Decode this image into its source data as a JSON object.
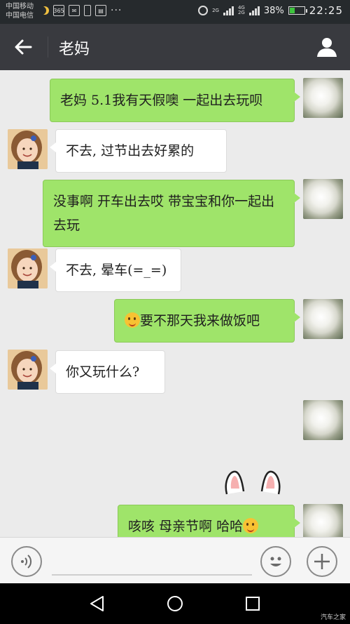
{
  "status_bar": {
    "carrier_1": "中国移动",
    "carrier_2": "中国电信",
    "icon_label_365": "365",
    "network_a": "2G",
    "network_b": "4G",
    "network_c": "2G",
    "battery": "38%",
    "battery_level": 0.38,
    "time": "22:25"
  },
  "title_bar": {
    "title": "老妈"
  },
  "messages": [
    {
      "side": "out",
      "text": "老妈 5.1我有天假噢 一起出去玩呗"
    },
    {
      "side": "in",
      "text": "不去, 过节出去好累的"
    },
    {
      "side": "out",
      "text": "没事啊 开车出去哎 带宝宝和你一起出去玩"
    },
    {
      "side": "in",
      "text": "不去, 晕车(=_=)"
    },
    {
      "side": "out",
      "text": "要不那天我来做饭吧",
      "emoji": "pleading-face"
    },
    {
      "side": "in",
      "text": "你又玩什么?"
    },
    {
      "side": "out",
      "sticker": "bunny-sticker"
    },
    {
      "side": "out",
      "text": "咳咳 母亲节啊 哈哈",
      "emoji": "grinning-face"
    }
  ],
  "input_bar": {
    "voice_icon": "voice-icon",
    "emoji_icon": "smiley-icon",
    "more_icon": "plus-icon"
  },
  "nav_bar": {
    "back_icon": "triangle-back-icon",
    "home_icon": "circle-home-icon",
    "recents_icon": "square-recents-icon"
  },
  "watermark": "汽车之家",
  "colors": {
    "outgoing_bubble": "#9fe46a",
    "incoming_bubble": "#ffffff",
    "chat_background": "#ebebeb",
    "title_bar": "#393a3f",
    "status_bar": "#262a2d"
  }
}
